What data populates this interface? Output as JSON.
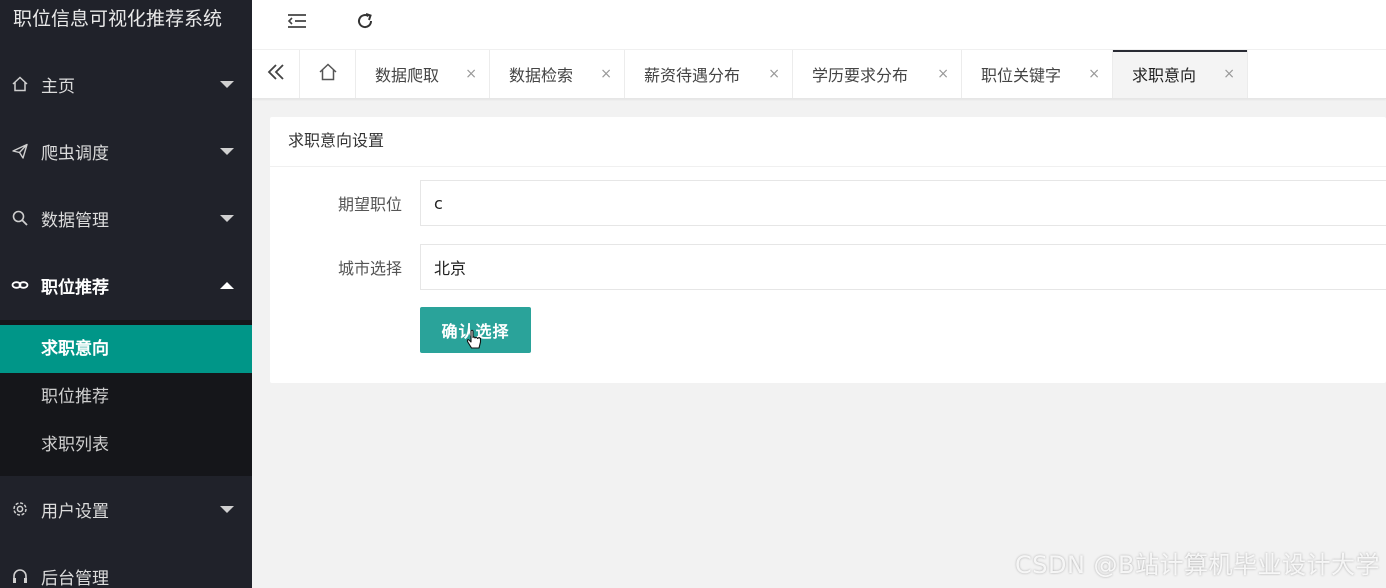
{
  "app": {
    "title": "职位信息可视化推荐系统"
  },
  "sidebar": {
    "items": [
      {
        "label": "主页",
        "icon": "home-icon",
        "expanded": false
      },
      {
        "label": "爬虫调度",
        "icon": "paper-plane-icon",
        "expanded": false
      },
      {
        "label": "数据管理",
        "icon": "search-icon",
        "expanded": false
      },
      {
        "label": "职位推荐",
        "icon": "link-icon",
        "expanded": true,
        "children": [
          {
            "label": "求职意向",
            "active": true
          },
          {
            "label": "职位推荐",
            "active": false
          },
          {
            "label": "求职列表",
            "active": false
          }
        ]
      },
      {
        "label": "用户设置",
        "icon": "gear-icon",
        "expanded": false
      },
      {
        "label": "后台管理",
        "icon": "headset-icon",
        "expanded": false
      }
    ]
  },
  "toolbar": {
    "collapse_icon": "indent-icon",
    "refresh_icon": "refresh-icon"
  },
  "tabs": {
    "nav_icon": "double-chevron-left-icon",
    "home_icon": "home-icon",
    "close_glyph": "×",
    "items": [
      {
        "label": "数据爬取",
        "active": false
      },
      {
        "label": "数据检索",
        "active": false
      },
      {
        "label": "薪资待遇分布",
        "active": false
      },
      {
        "label": "学历要求分布",
        "active": false
      },
      {
        "label": "职位关键字",
        "active": false
      },
      {
        "label": "求职意向",
        "active": true
      }
    ]
  },
  "form": {
    "title": "求职意向设置",
    "fields": [
      {
        "label": "期望职位",
        "value": "c"
      },
      {
        "label": "城市选择",
        "value": "北京"
      }
    ],
    "submit_label": "确认选择"
  },
  "watermark": "CSDN @B站计算机毕业设计大学",
  "colors": {
    "sidebar_bg": "#20222a",
    "accent": "#009688",
    "button": "#2aa39a"
  }
}
